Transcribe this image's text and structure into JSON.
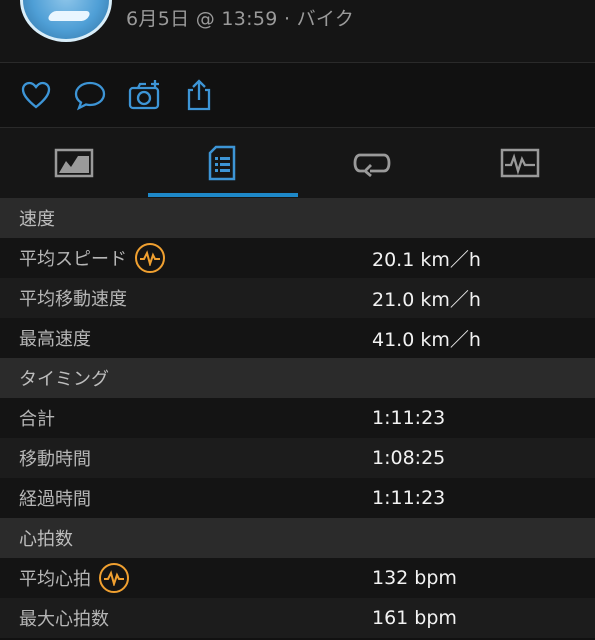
{
  "header": {
    "activity_meta": "6月5日 @ 13:59 · バイク"
  },
  "actions": {
    "like_icon": "heart-icon",
    "comment_icon": "comment-icon",
    "photo_icon": "add-photo-icon",
    "share_icon": "share-icon"
  },
  "tabs": [
    {
      "icon": "summary-graph-icon",
      "active": false
    },
    {
      "icon": "details-list-icon",
      "active": true
    },
    {
      "icon": "laps-icon",
      "active": false
    },
    {
      "icon": "charts-icon",
      "active": false
    }
  ],
  "colors": {
    "accent": "#1e88c8",
    "badge": "#f0a030",
    "section_bg": "#2b2b2b"
  },
  "stats": {
    "speed": {
      "title": "速度",
      "avg_speed_label": "平均スピード",
      "avg_speed_value": "20.1 km／h",
      "avg_moving_speed_label": "平均移動速度",
      "avg_moving_speed_value": "21.0 km／h",
      "max_speed_label": "最高速度",
      "max_speed_value": "41.0 km／h"
    },
    "timing": {
      "title": "タイミング",
      "total_label": "合計",
      "total_value": "1:11:23",
      "moving_time_label": "移動時間",
      "moving_time_value": "1:08:25",
      "elapsed_time_label": "経過時間",
      "elapsed_time_value": "1:11:23"
    },
    "heart_rate": {
      "title": "心拍数",
      "avg_hr_label": "平均心拍",
      "avg_hr_value": "132 bpm",
      "max_hr_label": "最大心拍数",
      "max_hr_value": "161 bpm"
    }
  }
}
